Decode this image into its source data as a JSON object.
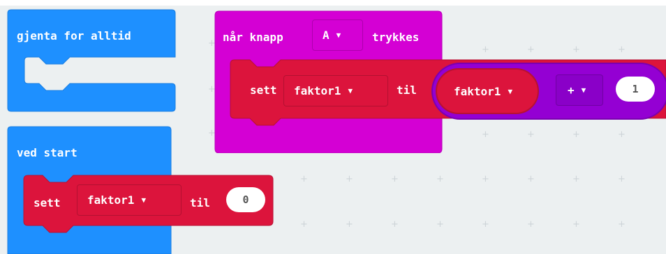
{
  "blocks": {
    "forever": {
      "label": "gjenta for alltid"
    },
    "on_start": {
      "label": "ved start"
    },
    "set_start": {
      "set_label": "sett",
      "variable": "faktor1",
      "to_label": "til",
      "value": "0"
    },
    "on_button": {
      "when_label": "når knapp",
      "button": "A",
      "pressed_label": "trykkes"
    },
    "set_button": {
      "set_label": "sett",
      "variable": "faktor1",
      "to_label": "til",
      "left_operand": "faktor1",
      "operator": "+",
      "right_operand": "1"
    }
  },
  "colors": {
    "loops": "#1e90ff",
    "variables": "#dc143c",
    "input": "#d400d4",
    "math": "#9400d3",
    "workspace": "#ecf0f1"
  },
  "icons": {
    "dropdown": "caret-down-icon"
  }
}
